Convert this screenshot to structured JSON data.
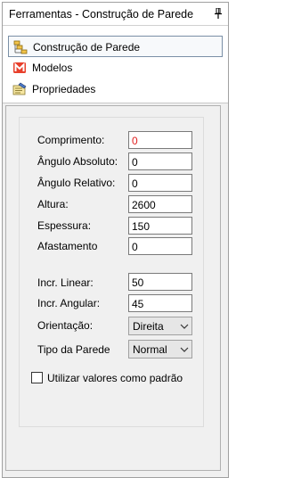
{
  "panel": {
    "title": "Ferramentas - Construção de Parede",
    "pin_icon": "pin-icon"
  },
  "nav": {
    "items": [
      {
        "label": "Construção de Parede",
        "icon": "wall-construction-icon",
        "selected": true
      },
      {
        "label": "Modelos",
        "icon": "models-icon",
        "selected": false
      },
      {
        "label": "Propriedades",
        "icon": "properties-icon",
        "selected": false
      }
    ]
  },
  "form": {
    "comprimento": {
      "label": "Comprimento:",
      "value": "0",
      "value_color": "#e02020"
    },
    "angulo_absoluto": {
      "label": "Ângulo Absoluto:",
      "value": "0"
    },
    "angulo_relativo": {
      "label": "Ângulo Relativo:",
      "value": "0"
    },
    "altura": {
      "label": "Altura:",
      "value": "2600"
    },
    "espessura": {
      "label": "Espessura:",
      "value": "150"
    },
    "afastamento": {
      "label": "Afastamento",
      "value": "0"
    },
    "incr_linear": {
      "label": "Incr. Linear:",
      "value": "50"
    },
    "incr_angular": {
      "label": "Incr. Angular:",
      "value": "45"
    },
    "orientacao": {
      "label": "Orientação:",
      "selected": "Direita"
    },
    "tipo_parede": {
      "label": "Tipo da Parede",
      "selected": "Normal"
    },
    "default_checkbox": {
      "label": "Utilizar valores como padrão",
      "checked": false
    }
  }
}
